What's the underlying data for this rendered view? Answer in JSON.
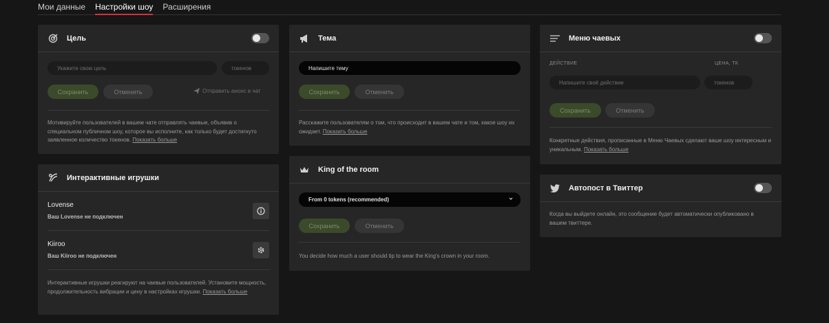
{
  "tabs": [
    "Мои данные",
    "Настройки шоу",
    "Расширения"
  ],
  "goal": {
    "title": "Цель",
    "goal_placeholder": "Укажите свою цель",
    "tokens_placeholder": "токенов",
    "save": "Сохранить",
    "cancel": "Отменить",
    "announce": "Отправить анонс в чат",
    "desc": "Мотивируйте пользователей в вашем чате отправлять чаевые, объявив о специальном публичном шоу, которое вы исполните, как только будет достигнуто заявленное количество токенов.",
    "more": "Показать больше"
  },
  "toys": {
    "title": "Интерактивные игрушки",
    "items": [
      {
        "name": "Lovense",
        "status": "Ваш Lovense не подключен",
        "icon": "info-icon"
      },
      {
        "name": "Kiiroo",
        "status": "Ваш Kiiroo не подключен",
        "icon": "gear-icon"
      }
    ],
    "desc": "Интерактивные игрушки реагируют на чаевые пользователей. Установите мощность, продолжительность вибрации и цену в настройках игрушки.",
    "more": "Показать больше"
  },
  "topic": {
    "title": "Тема",
    "placeholder": "Напишите тему",
    "save": "Сохранить",
    "cancel": "Отменить",
    "desc": "Расскажите пользователям о том, что происходит в вашем чате и том, какое шоу их ожидает.",
    "more": "Показать больше"
  },
  "king": {
    "title": "King of the room",
    "selected": "From 0 tokens (recommended)",
    "save": "Сохранить",
    "cancel": "Отменить",
    "desc": "You decide how much a user should tip to wear the King's crown in your room."
  },
  "tipmenu": {
    "title": "Меню чаевых",
    "col_action": "ДЕЙСТВИЕ",
    "col_price": "ЦЕНА, ТК",
    "action_placeholder": "Напишите своё действие",
    "tokens_placeholder": "токенов",
    "save": "Сохранить",
    "cancel": "Отменить",
    "desc": "Конкретные действия, прописанные в Меню Чаевых сделают ваше шоу интересным и уникальным.",
    "more": "Показать больше"
  },
  "twitter": {
    "title": "Автопост в Твиттер",
    "desc": "Когда вы выйдете онлайн, это сообщение будет автоматически опубликовано в вашем твиттере."
  }
}
